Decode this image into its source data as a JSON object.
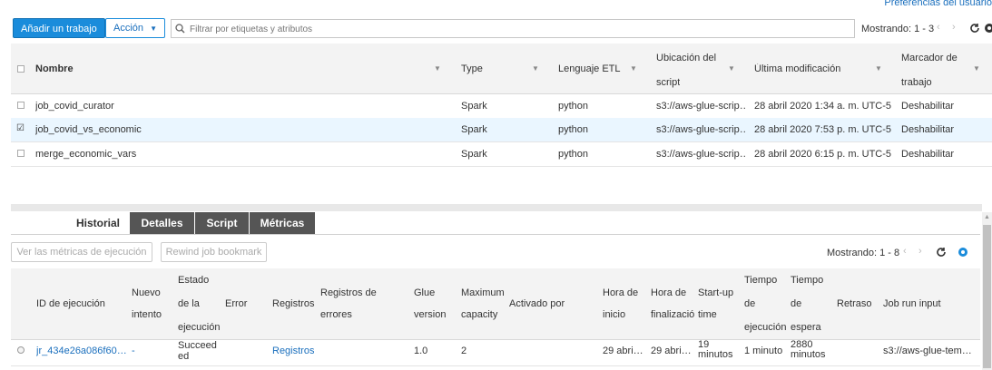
{
  "top_link": "Preferencias del usuario",
  "toolbar": {
    "add_job": "Añadir un trabajo",
    "action": "Acción",
    "filter_placeholder": "Filtrar por etiquetas y atributos",
    "showing": "Mostrando: 1 - 3"
  },
  "jobs": {
    "headers": {
      "name": "Nombre",
      "type": "Type",
      "etl": "Lenguaje ETL",
      "script_1": "Ubicación del",
      "script_2": "script",
      "modified": "Última modificación",
      "bookmark_1": "Marcador de",
      "bookmark_2": "trabajo"
    },
    "rows": [
      {
        "name": "job_covid_curator",
        "type": "Spark",
        "lang": "python",
        "script": "s3://aws-glue-scrip…",
        "modified": "28 abril 2020 1:34 a. m. UTC-5",
        "bookmark": "Deshabilitar",
        "checked": false
      },
      {
        "name": "job_covid_vs_economic",
        "type": "Spark",
        "lang": "python",
        "script": "s3://aws-glue-scrip…",
        "modified": "28 abril 2020 7:53 p. m. UTC-5",
        "bookmark": "Deshabilitar",
        "checked": true
      },
      {
        "name": "merge_economic_vars",
        "type": "Spark",
        "lang": "python",
        "script": "s3://aws-glue-scrip…",
        "modified": "28 abril 2020 6:15 p. m. UTC-5",
        "bookmark": "Deshabilitar",
        "checked": false
      }
    ]
  },
  "tabs": [
    "Historial",
    "Detalles",
    "Script",
    "Métricas"
  ],
  "runs_toolbar": {
    "metrics_btn": "Ver las métricas de ejecución",
    "rewind_btn": "Rewind job bookmark",
    "showing": "Mostrando: 1 - 8"
  },
  "runs": {
    "headers": {
      "id": "ID de ejecución",
      "retry_1": "Nuevo",
      "retry_2": "intento",
      "status_1": "Estado",
      "status_2": "de la",
      "status_3": "ejecución",
      "error": "Error",
      "logs": "Registros",
      "errlogs_1": "Registros de",
      "errlogs_2": "errores",
      "glue_1": "Glue",
      "glue_2": "version",
      "maxcap_1": "Maximum",
      "maxcap_2": "capacity",
      "trigger": "Activado por",
      "start_1": "Hora de",
      "start_2": "inicio",
      "end_1": "Hora de",
      "end_2": "finalizació",
      "startup_1": "Start-up",
      "startup_2": "time",
      "exec_1": "Tiempo",
      "exec_2": "de",
      "exec_3": "ejecución",
      "wait_1": "Tiempo",
      "wait_2": "de",
      "wait_3": "espera",
      "delay": "Retraso",
      "input": "Job run input"
    },
    "row": {
      "id": "jr_434e26a086f60…",
      "retry": "-",
      "status_1": "Succeed",
      "status_2": "ed",
      "logs": "Registros",
      "glue": "1.0",
      "maxcap": "2",
      "start": "29 abri…",
      "end": "29 abri…",
      "startup_1": "19",
      "startup_2": "minutos",
      "exec": "1 minuto",
      "wait_1": "2880",
      "wait_2": "minutos",
      "input": "s3://aws-glue-tem…"
    }
  }
}
